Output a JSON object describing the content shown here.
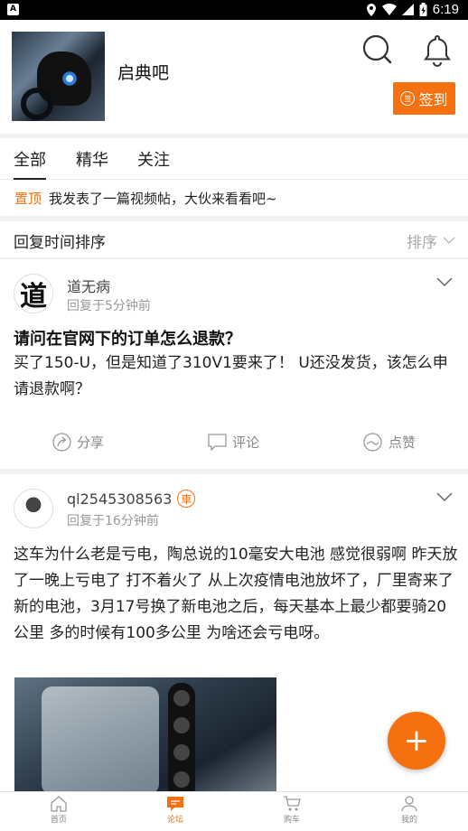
{
  "statusbar": {
    "app_badge": "A",
    "time": "6:19"
  },
  "header": {
    "forum_name": "启典吧",
    "sign_label": "签到",
    "sign_icon_text": "签"
  },
  "tabs": [
    {
      "label": "全部"
    },
    {
      "label": "精华"
    },
    {
      "label": "关注"
    }
  ],
  "pinned": {
    "badge": "置顶",
    "text": "我发表了一篇视频帖，大伙来看看吧~"
  },
  "sortbar": {
    "label": "回复时间排序",
    "sort_label": "排序"
  },
  "posts": [
    {
      "avatar_char": "道",
      "username": "道无病",
      "time": "回复于5分钟前",
      "title": "请问在官网下的订单怎么退款？",
      "body": "买了150-U，但是知道了310V1要来了！ U还没发货，该怎么申请退款啊？",
      "actions": {
        "share": "分享",
        "comment": "评论",
        "like": "点赞"
      }
    },
    {
      "username": "ql2545308563",
      "level_badge": "車",
      "time": "回复于16分钟前",
      "body": "这车为什么老是亏电，陶总说的10毫安大电池 感觉很弱啊 昨天放了一晚上亏电了 打不着火了 从上次疫情电池放坏了，厂里寄来了新的电池，3月17号换了新电池之后，每天基本上最少都要骑20公里 多的时候有100多公里 为啥还会亏电呀。"
    }
  ],
  "fab": {
    "label": "+"
  },
  "navbar": [
    {
      "label": "首页",
      "icon": "home-icon"
    },
    {
      "label": "论坛",
      "icon": "forum-icon"
    },
    {
      "label": "购车",
      "icon": "cart-icon"
    },
    {
      "label": "我的",
      "icon": "profile-icon"
    }
  ],
  "colors": {
    "accent": "#f5700f"
  }
}
